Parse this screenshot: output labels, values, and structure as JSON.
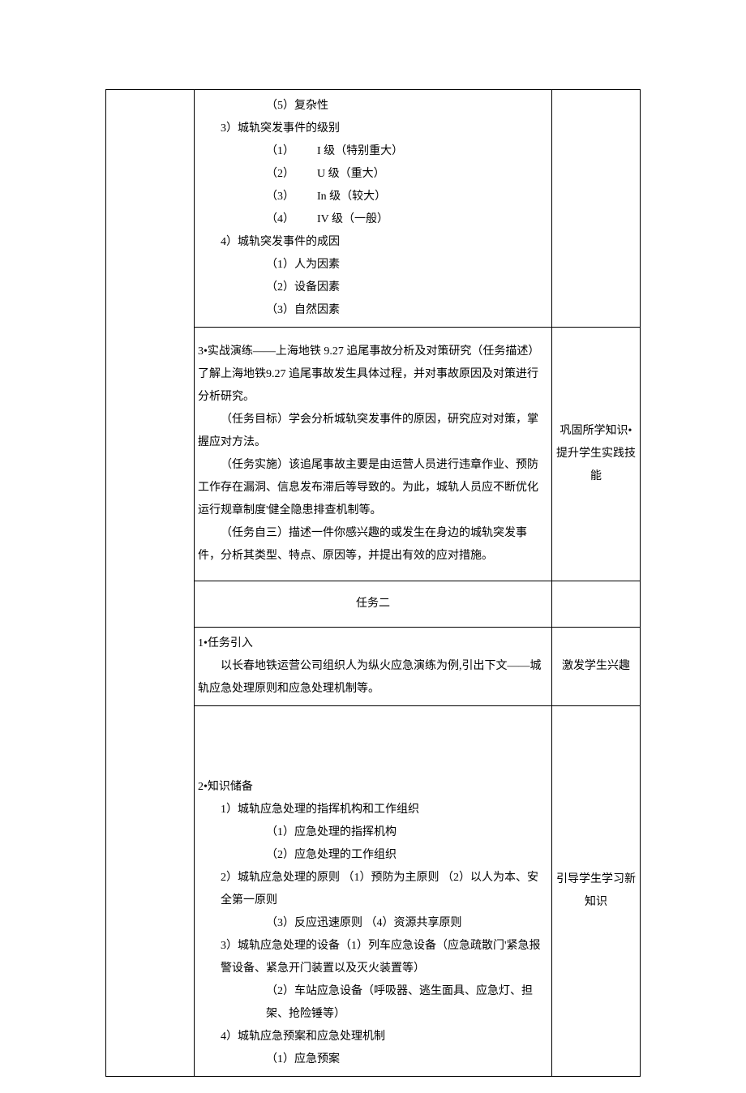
{
  "cell1": {
    "l5": "（5）复杂性",
    "h3": "3）城轨突发事件的级别",
    "lvl1": "（1）",
    "lvl1b": "I 级（特别重大）",
    "lvl2": "（2）",
    "lvl2b": "U 级（重大）",
    "lvl3": "（3）",
    "lvl3b": "In 级（较大）",
    "lvl4": "（4）",
    "lvl4b": "IV 级（一般）",
    "h4": "4）城轨突发事件的成因",
    "c1": "（1）人为因素",
    "c2": "（2）设备因素",
    "c3": "（3）自然因素"
  },
  "cell2": {
    "p1": "3•实战演练——上海地铁 9.27 追尾事故分析及对策研究（任务描述）了解上海地铁9.27 追尾事故发生具体过程，并对事故原因及对策进行分析研究。",
    "p2": "（任务目标）学会分析城轨突发事件的原因，研究应对对策，掌握应对方法。",
    "p3": "（任务实施）该追尾事故主要是由运营人员进行违章作业、预防工作存在漏洞、信息发布滞后等导致的。为此，城轨人员应不断优化运行规章制度'健全隐患排查机制等。",
    "p4": "（任务自三）描述一件你感兴趣的或发生在身边的城轨突发事件，分析其类型、特点、原因等，并提出有效的应对措施。",
    "right": "巩固所学知识•提升学生实践技能"
  },
  "task2": "任务二",
  "cell3": {
    "p1": "1•任务引入",
    "p2": "以长春地铁运营公司组织人为纵火应急演练为例,引出下文——城轨应急处理原则和应急处理机制等。",
    "right": "激发学生兴趣"
  },
  "cell4": {
    "p1": "2•知识储备",
    "h1": "1）城轨应急处理的指挥机构和工作组织",
    "h1a": "（1）应急处理的指挥机构",
    "h1b": "（2）应急处理的工作组织",
    "h2": "2）城轨应急处理的原则 （1）预防为主原则 （2）以人为本、安全第一原则",
    "h2b": "（3）反应迅速原则 （4）资源共享原则",
    "h3": "3）城轨应急处理的设备（1）列车应急设备（应急疏散门'紧急报警设备、紧急开门装置以及灭火装置等）",
    "h3b": "（2）车站应急设备（呼吸器、逃生面具、应急灯、担架、抢险锤等）",
    "h4": "4）城轨应急预案和应急处理机制",
    "h4a": "（1）应急预案",
    "right": "引导学生学习新知识"
  }
}
